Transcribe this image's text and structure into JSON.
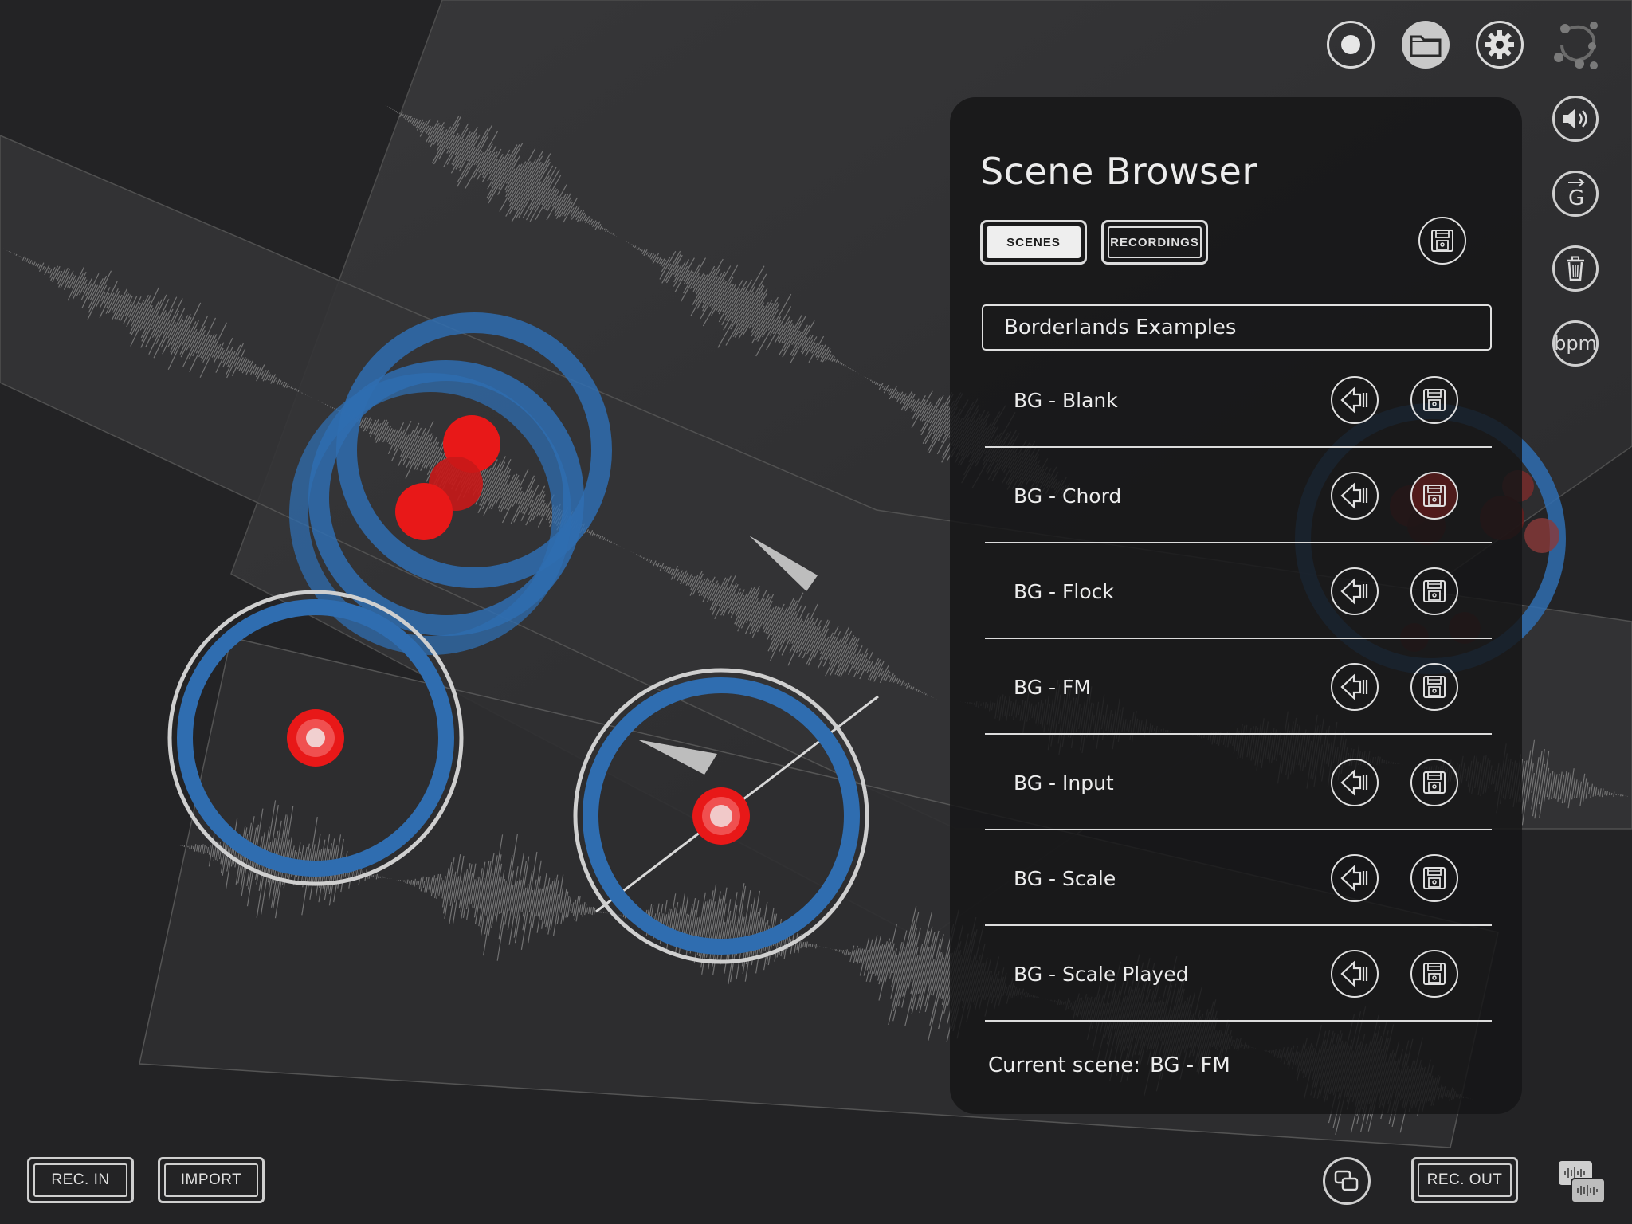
{
  "toolbar": {
    "record_icon": "record-icon",
    "folder_icon": "folder-icon",
    "settings_icon": "gear-icon",
    "logo_icon": "borderlands-logo-icon"
  },
  "side_buttons": {
    "volume_icon": "speaker-icon",
    "g_label": "G",
    "trash_icon": "trash-icon",
    "bpm_label": "bpm"
  },
  "scene_browser": {
    "title": "Scene Browser",
    "tabs": {
      "scenes": "SCENES",
      "recordings": "RECORDINGS"
    },
    "folder": "Borderlands Examples",
    "scenes": [
      {
        "name": "BG - Blank"
      },
      {
        "name": "BG - Chord"
      },
      {
        "name": "BG - Flock"
      },
      {
        "name": "BG - FM"
      },
      {
        "name": "BG - Input"
      },
      {
        "name": "BG - Scale"
      },
      {
        "name": "BG - Scale Played"
      }
    ],
    "current_label": "Current scene:",
    "current_value": "BG - FM"
  },
  "bottom": {
    "rec_in": "REC. IN",
    "import": "IMPORT",
    "rec_out": "REC. OUT"
  },
  "colors": {
    "background": "#232325",
    "cloud_blue": "#2f6db0",
    "grain_red": "#e81818",
    "waveform": "#8a8a8a"
  }
}
